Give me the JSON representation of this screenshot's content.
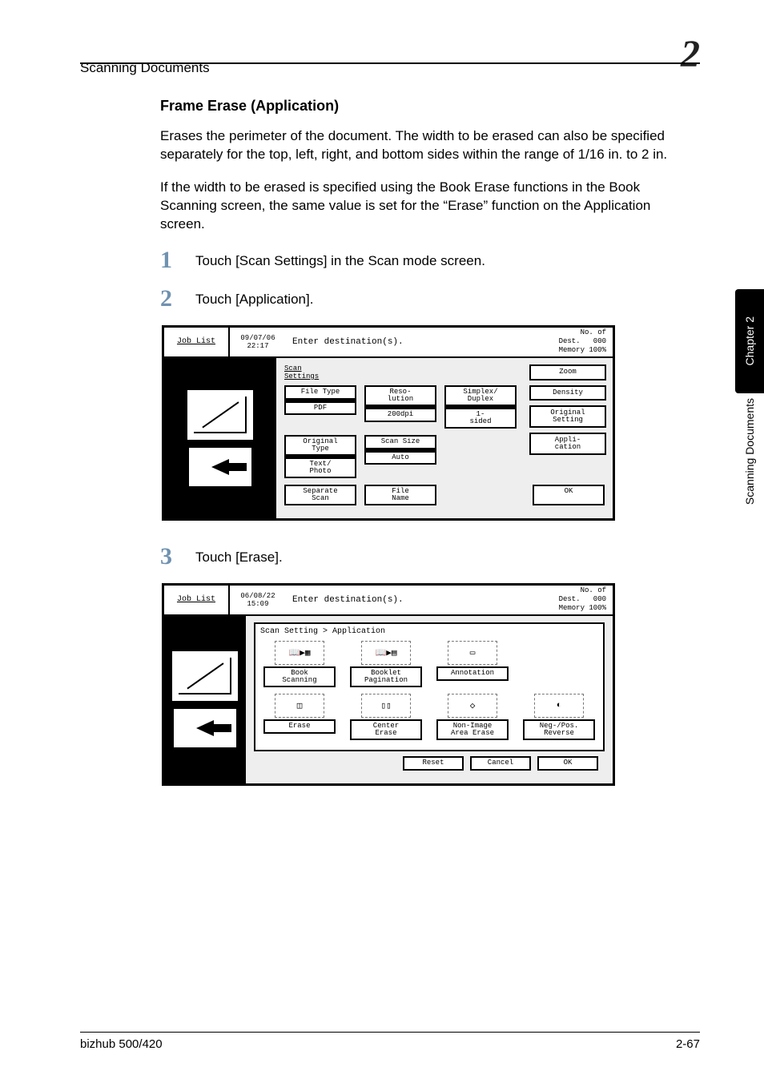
{
  "header": {
    "running": "Scanning Documents",
    "chapter_glyph": "2"
  },
  "side_tab": {
    "chapter": "Chapter 2",
    "section": "Scanning Documents"
  },
  "footer": {
    "left": "bizhub 500/420",
    "right": "2-67"
  },
  "content": {
    "heading": "Frame Erase (Application)",
    "p1": "Erases the perimeter of the document. The width to be erased can also be specified separately for the top, left, right, and bottom sides within the range of 1/16 in. to 2 in.",
    "p2": "If the width to be erased is specified using the Book Erase functions in the Book Scanning screen, the same value is set for the “Erase” function on the Application screen.",
    "steps": {
      "s1": {
        "num": "1",
        "text": "Touch [Scan Settings] in the Scan mode screen."
      },
      "s2": {
        "num": "2",
        "text": "Touch [Application]."
      },
      "s3": {
        "num": "3",
        "text": "Touch [Erase]."
      }
    }
  },
  "panel_common": {
    "job_list": "Job\nList",
    "enter_dest": "Enter destination(s).",
    "no_of_dest_lbl": "No. of\nDest.",
    "dest_count": "000",
    "memory": "Memory 100%"
  },
  "panel1": {
    "datetime": "09/07/06\n22:17",
    "section_label": "Scan\nSettings",
    "file_type": "File Type",
    "file_type_val": "PDF",
    "reso": "Reso-\nlution",
    "reso_val": "200dpi",
    "simplex": "Simplex/\nDuplex",
    "simplex_val": "1-\nsided",
    "orig_type": "Original\nType",
    "orig_type_val": "Text/\nPhoto",
    "scan_size": "Scan Size",
    "scan_size_val": "Auto",
    "separate": "Separate\nScan",
    "file_name": "File\nName",
    "right": {
      "zoom": "Zoom",
      "density": "Density",
      "orig": "Original\nSetting",
      "appli": "Appli-\ncation"
    },
    "ok": "OK"
  },
  "panel2": {
    "datetime": "06/08/22\n15:09",
    "breadcrumb": "Scan Setting > Application",
    "items": {
      "book_scan": "Book\nScanning",
      "booklet": "Booklet\nPagination",
      "annotation": "Annotation",
      "erase": "Erase",
      "center_erase": "Center\nErase",
      "non_image": "Non-Image\nArea Erase",
      "neg_pos": "Neg-/Pos.\nReverse"
    },
    "reset": "Reset",
    "cancel": "Cancel",
    "ok": "OK"
  }
}
